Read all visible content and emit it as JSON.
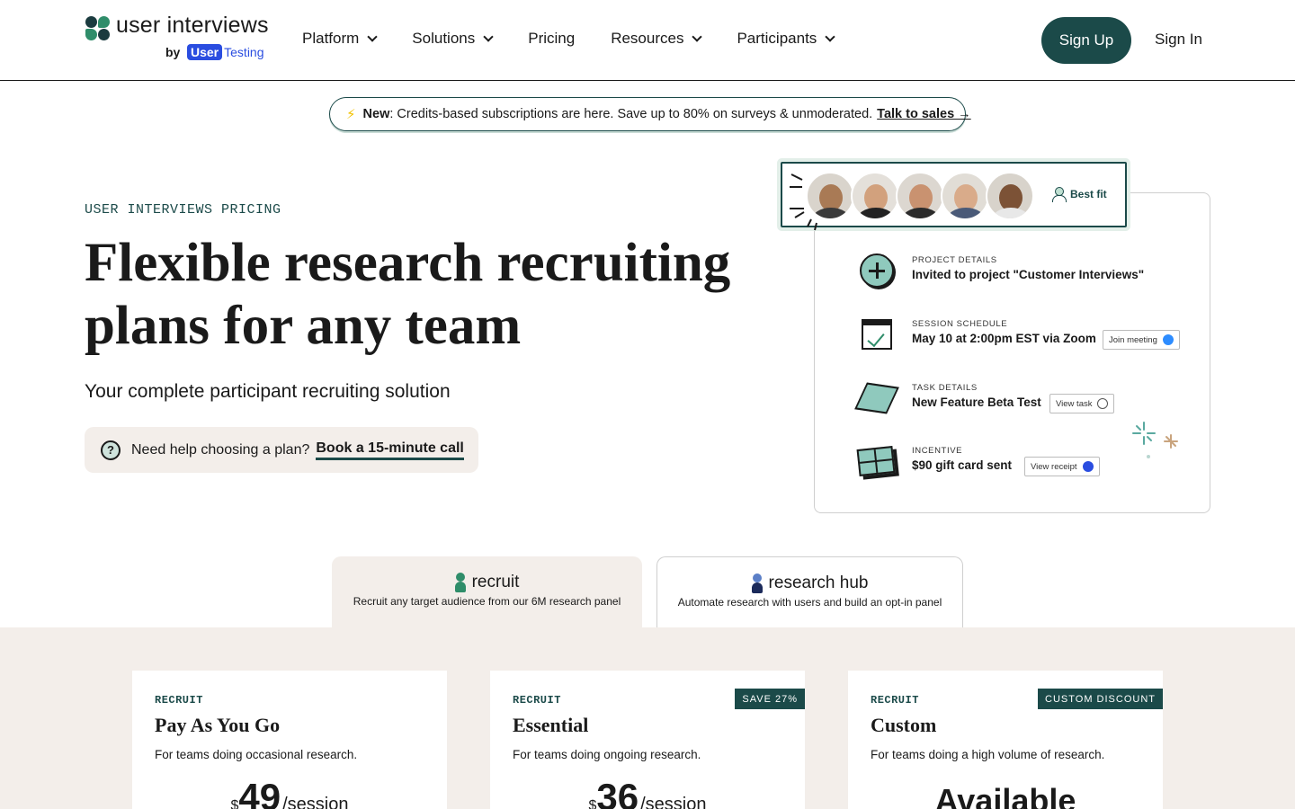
{
  "header": {
    "logo_text": "user interviews",
    "logo_by": "by",
    "logo_ut_user": "User",
    "logo_ut_testing": "Testing",
    "nav": [
      {
        "label": "Platform",
        "has_dropdown": true
      },
      {
        "label": "Solutions",
        "has_dropdown": true
      },
      {
        "label": "Pricing",
        "has_dropdown": false
      },
      {
        "label": "Resources",
        "has_dropdown": true
      },
      {
        "label": "Participants",
        "has_dropdown": true
      }
    ],
    "signup_label": "Sign Up",
    "signin_label": "Sign In"
  },
  "announcement": {
    "icon": "lightning-bolt-icon",
    "new_label": "New",
    "text": ": Credits-based subscriptions are here. Save up to 80% on surveys & unmoderated.",
    "cta": "Talk to sales →"
  },
  "hero": {
    "eyebrow": "USER INTERVIEWS PRICING",
    "title": "Flexible research recruiting plans for any team",
    "subtitle": "Your complete participant recruiting solution",
    "help_icon_glyph": "?",
    "help_text": "Need help choosing a plan?",
    "help_link": "Book a 15-minute call"
  },
  "hero_card": {
    "best_fit": "Best fit",
    "details": [
      {
        "label": "PROJECT DETAILS",
        "value": "Invited to project \"Customer Interviews\"",
        "chip": ""
      },
      {
        "label": "SESSION SCHEDULE",
        "value": "May 10 at 2:00pm EST via Zoom",
        "chip": "Join meeting"
      },
      {
        "label": "TASK DETAILS",
        "value": "New Feature Beta Test",
        "chip": "View task"
      },
      {
        "label": "INCENTIVE",
        "value": "$90 gift card sent",
        "chip": "View receipt"
      }
    ]
  },
  "tabs": [
    {
      "title": "recruit",
      "desc": "Recruit any target audience from our 6M research panel",
      "active": true
    },
    {
      "title": "research hub",
      "desc": "Automate research with users and build an opt-in panel",
      "active": false
    }
  ],
  "plans": [
    {
      "eyebrow": "RECRUIT",
      "title": "Pay As You Go",
      "desc": "For teams doing occasional research.",
      "badge": "",
      "currency": "$",
      "amount": "49",
      "per": "/session"
    },
    {
      "eyebrow": "RECRUIT",
      "title": "Essential",
      "desc": "For teams doing ongoing research.",
      "badge": "SAVE 27%",
      "currency": "$",
      "amount": "36",
      "per": "/session"
    },
    {
      "eyebrow": "RECRUIT",
      "title": "Custom",
      "desc": "For teams doing a high volume of research.",
      "badge": "CUSTOM DISCOUNT",
      "available": "Available"
    }
  ],
  "colors": {
    "brand_dark": "#1b4a49",
    "brand_green": "#2f8d6a",
    "panel_beige": "#f3eeea",
    "usertesting_blue": "#2a4de0"
  }
}
